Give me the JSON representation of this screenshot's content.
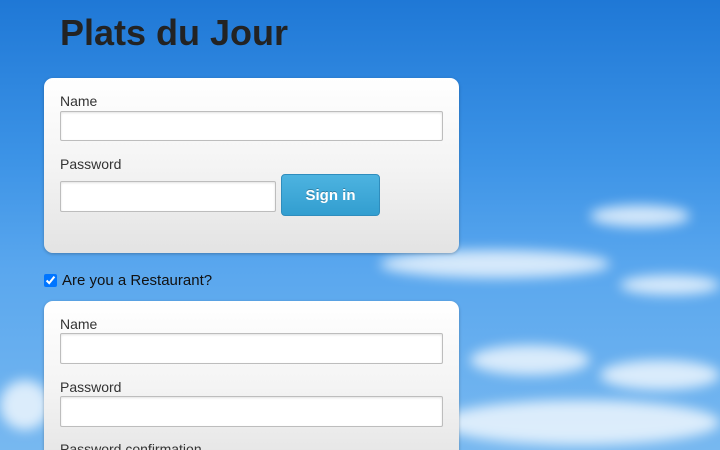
{
  "page": {
    "title": "Plats du Jour"
  },
  "signin": {
    "name_label": "Name",
    "name_value": "",
    "password_label": "Password",
    "password_value": "",
    "submit_label": "Sign in"
  },
  "restaurant_toggle": {
    "label": "Are you a Restaurant?",
    "checked": true
  },
  "restaurant_form": {
    "name_label": "Name",
    "name_value": "",
    "password_label": "Password",
    "password_value": "",
    "password_confirmation_label": "Password confirmation"
  },
  "colors": {
    "sky": "#3c93e6",
    "button": "#3aa4d4",
    "title": "#232323"
  }
}
